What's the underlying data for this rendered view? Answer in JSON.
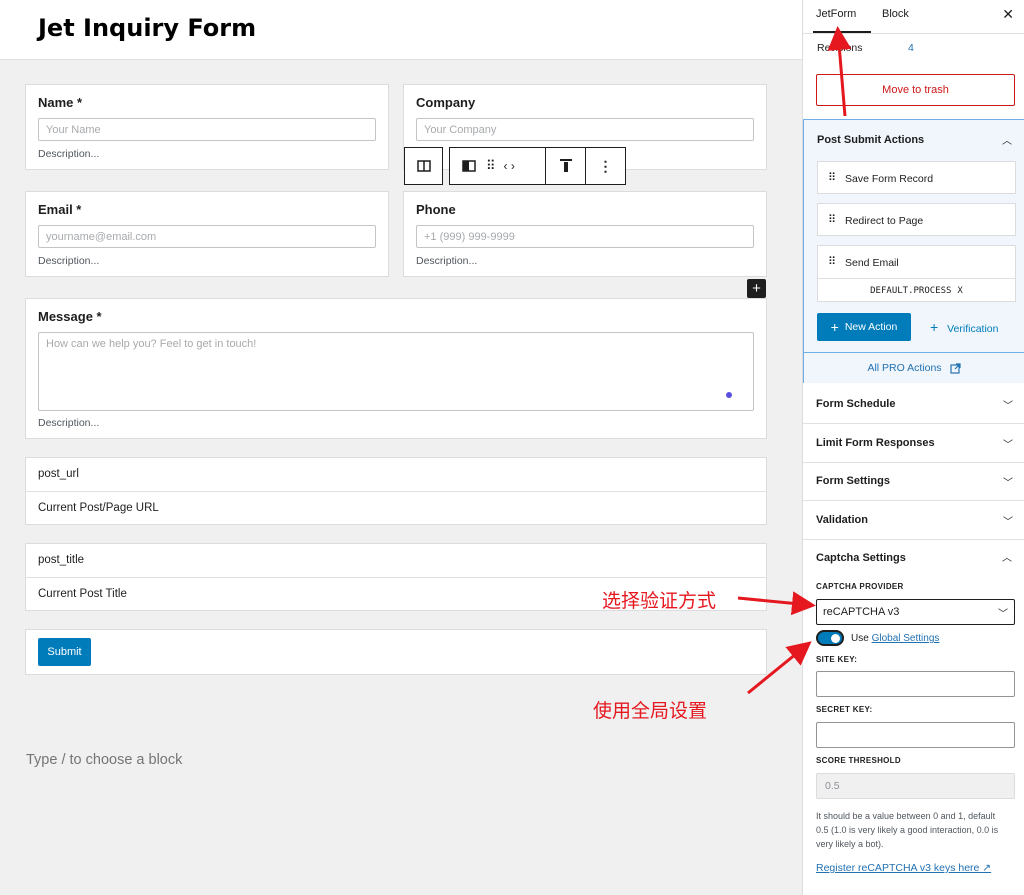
{
  "editor": {
    "page_title": "Jet Inquiry Form",
    "fields": [
      {
        "label": "Name *",
        "placeholder": "Your Name",
        "description": "Description..."
      },
      {
        "label": "Company",
        "placeholder": "Your Company",
        "description": "Description..."
      },
      {
        "label": "Email *",
        "placeholder": "yourname@email.com",
        "description": "Description..."
      },
      {
        "label": "Phone",
        "placeholder": "+1 (999) 999-9999",
        "description": "Description..."
      },
      {
        "label": "Message *",
        "placeholder": "How can we help you? Feel to get in touch!",
        "description": "Description..."
      }
    ],
    "hidden_fields": [
      {
        "name": "post_url",
        "value": "Current Post/Page URL"
      },
      {
        "name": "post_title",
        "value": "Current Post Title"
      }
    ],
    "submit_label": "Submit",
    "type_hint": "Type / to choose a block",
    "add_block_glyph": "+"
  },
  "sidebar": {
    "tabs": [
      "JetForm",
      "Block"
    ],
    "close_glyph": "✕",
    "revisions_label": "Revisions",
    "revisions_count": "4",
    "trash_label": "Move to trash",
    "post_submit": {
      "title": "Post Submit Actions",
      "actions": [
        "Save Form Record",
        "Redirect to Page",
        "Send Email"
      ],
      "send_email_chip": "DEFAULT.PROCESS",
      "chip_remove": "X",
      "new_action_label": "New Action",
      "verification_label": "Verification",
      "all_pro_label": "All PRO Actions"
    },
    "panels": [
      "Form Schedule",
      "Limit Form Responses",
      "Form Settings",
      "Validation"
    ],
    "captcha": {
      "title": "Captcha Settings",
      "provider_label": "CAPTCHA PROVIDER",
      "provider_value": "reCAPTCHA v3",
      "use_prefix": "Use",
      "use_link": "Global Settings",
      "use_global": true,
      "site_key_label": "SITE KEY:",
      "secret_key_label": "SECRET KEY:",
      "threshold_label": "SCORE THRESHOLD",
      "threshold_value": "0.5",
      "help": "It should be a value between 0 and 1, default 0.5 (1.0 is very likely a good interaction, 0.0 is very likely a bot).",
      "register_link": "Register reCAPTCHA v3 keys here ↗"
    }
  },
  "annotations": {
    "select_provider": "选择验证方式",
    "use_global": "使用全局设置"
  },
  "colors": {
    "accent": "#007cba",
    "danger": "#cc1818",
    "annotation": "#e5181f",
    "panel_highlight": "#f0f6fc"
  }
}
